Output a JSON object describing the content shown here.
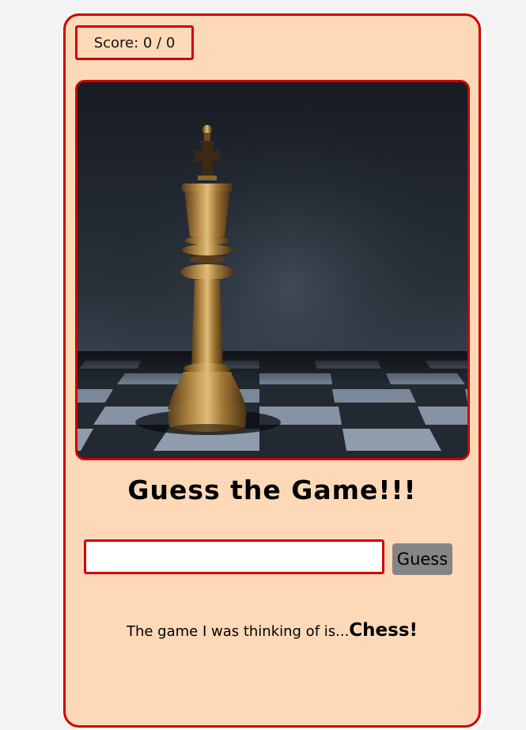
{
  "score": {
    "text": "Score: 0 / 0"
  },
  "game": {
    "title": "Guess the Game!!!",
    "input_value": "",
    "guess_label": "Guess",
    "result_prefix": "The game I was thinking of is...",
    "result_answer": "Chess!"
  },
  "image": {
    "subject": "chess-king-on-chessboard"
  },
  "colors": {
    "card_background": "#fdd9b8",
    "accent_border": "#d10000",
    "button_background": "#858585",
    "page_background": "#f3f3f4"
  }
}
